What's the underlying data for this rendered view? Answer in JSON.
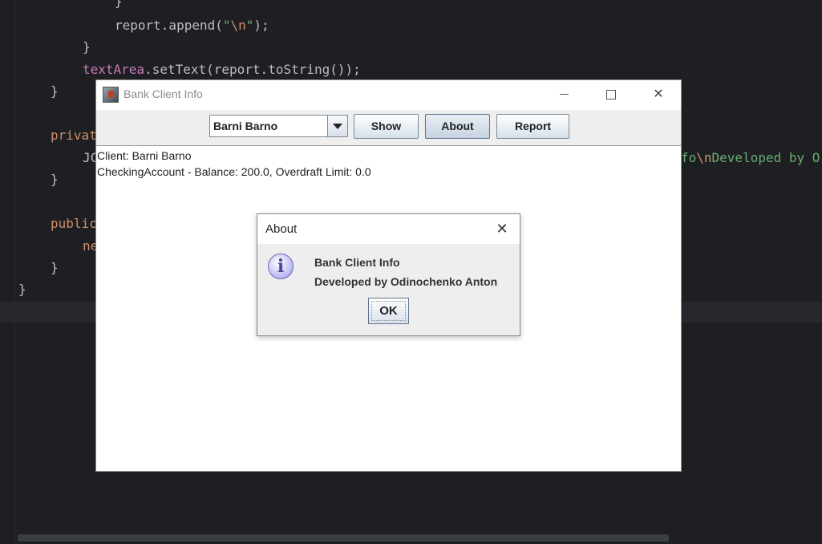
{
  "ide": {
    "code_lines": [
      {
        "segments": [
          {
            "t": "}",
            "c": ""
          }
        ]
      },
      {
        "segments": [
          {
            "t": "report.append(",
            "c": ""
          },
          {
            "t": "\"",
            "c": "str"
          },
          {
            "t": "\\n",
            "c": "esc"
          },
          {
            "t": "\"",
            "c": "str"
          },
          {
            "t": ");",
            "c": ""
          }
        ]
      },
      {
        "segments": [
          {
            "t": "}",
            "c": ""
          }
        ]
      },
      {
        "segments": [
          {
            "t": "textArea",
            "c": "field"
          },
          {
            "t": ".setText(report.toString());",
            "c": ""
          }
        ]
      },
      {
        "segments": [
          {
            "t": "}",
            "c": ""
          }
        ]
      },
      {
        "segments": [
          {
            "t": "privat",
            "c": "kw"
          }
        ]
      },
      {
        "segments": [
          {
            "t": "JC",
            "c": ""
          }
        ]
      },
      {
        "segments": [
          {
            "t": "}",
            "c": ""
          }
        ]
      },
      {
        "segments": [
          {
            "t": "public",
            "c": "kw"
          }
        ]
      },
      {
        "segments": [
          {
            "t": "ne",
            "c": "kw"
          }
        ]
      },
      {
        "segments": [
          {
            "t": "}",
            "c": ""
          }
        ]
      },
      {
        "segments": [
          {
            "t": "}",
            "c": ""
          }
        ]
      },
      {
        "segments": [
          {
            "t": "fo",
            "c": "str"
          },
          {
            "t": "\\n",
            "c": "esc"
          },
          {
            "t": "Developed by O",
            "c": "str"
          }
        ]
      }
    ]
  },
  "main_window": {
    "title": "Bank Client Info",
    "min_glyph": "",
    "max_glyph": "",
    "close_glyph": "✕",
    "client_select": {
      "selected": "Barni Barno"
    },
    "buttons": {
      "show": "Show",
      "about": "About",
      "report": "Report"
    },
    "text_area_lines": [
      "Client: Barni Barno",
      "CheckingAccount - Balance: 200.0, Overdraft Limit: 0.0"
    ]
  },
  "about_dialog": {
    "title": "About",
    "close_glyph": "✕",
    "icon": "info-icon",
    "icon_glyph": "i",
    "message_line1": "Bank Client Info",
    "message_line2": "Developed by Odinochenko Anton",
    "ok_label": "OK"
  }
}
